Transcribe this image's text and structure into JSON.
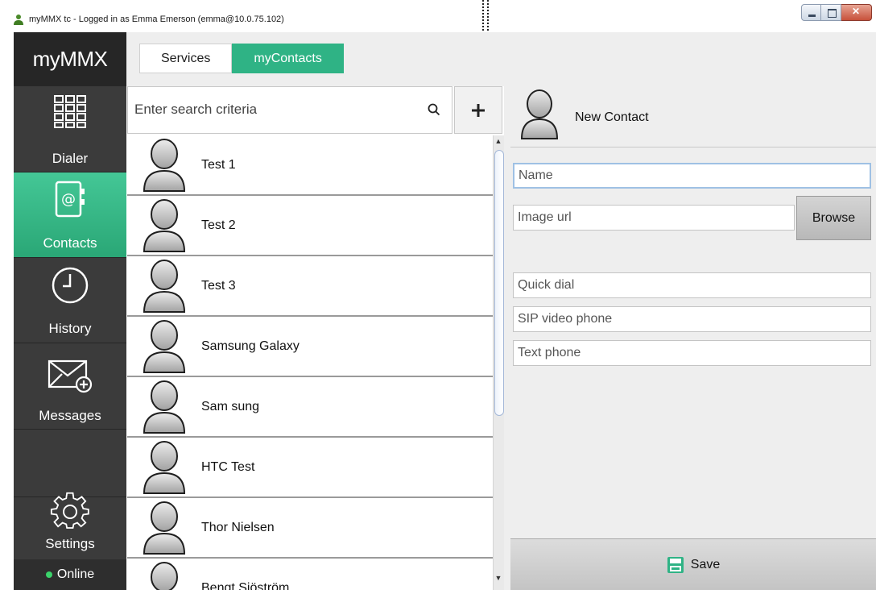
{
  "window": {
    "title": "myMMX tc - Logged in as Emma Emerson (emma@10.0.75.102)"
  },
  "sidebar": {
    "brand": "myMMX",
    "items": [
      {
        "label": "Dialer",
        "icon": "dialpad-icon",
        "active": false
      },
      {
        "label": "Contacts",
        "icon": "address-book-icon",
        "active": true
      },
      {
        "label": "History",
        "icon": "clock-icon",
        "active": false
      },
      {
        "label": "Messages",
        "icon": "envelope-add-icon",
        "active": false
      },
      {
        "label": "Settings",
        "icon": "gear-icon",
        "active": false
      }
    ],
    "status": "Online"
  },
  "tabs": [
    {
      "label": "Services",
      "active": false
    },
    {
      "label": "myContacts",
      "active": true
    }
  ],
  "search": {
    "placeholder": "Enter search criteria"
  },
  "contacts": [
    "Test 1",
    "Test 2",
    "Test 3",
    "Samsung Galaxy",
    "Sam sung",
    "HTC Test",
    "Thor Nielsen",
    "Bengt Sjöström"
  ],
  "form": {
    "title": "New Contact",
    "name_placeholder": "Name",
    "image_placeholder": "Image url",
    "browse_label": "Browse",
    "quick_dial_placeholder": "Quick dial",
    "sip_placeholder": "SIP video phone",
    "text_phone_placeholder": "Text phone",
    "save_label": "Save"
  },
  "colors": {
    "accent": "#2fb385",
    "sidebar_bg": "#3b3b3b",
    "online": "#3bd36b"
  }
}
